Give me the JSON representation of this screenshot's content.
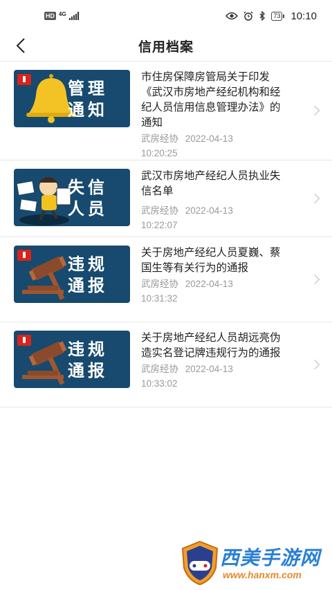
{
  "status_bar": {
    "hd": "HD",
    "network": "4G",
    "battery": "73",
    "time": "10:10"
  },
  "header": {
    "title": "信用档案",
    "back_icon": "back-chevron-icon"
  },
  "items": [
    {
      "thumb_text_line1": "管理",
      "thumb_text_line2": "通知",
      "thumb_icon": "bell-icon",
      "title": "市住房保障房管局关于印发《武汉市房地产经纪机构和经纪人员信用信息管理办法》的通知",
      "source": "武房经协",
      "date": "2022-04-13",
      "time": "10:20:25"
    },
    {
      "thumb_text_line1": "失信",
      "thumb_text_line2": "人员",
      "thumb_icon": "cartoon-person-icon",
      "title": "武汉市房地产经纪人员执业失信名单",
      "source": "武房经协",
      "date": "2022-04-13",
      "time": "10:22:07"
    },
    {
      "thumb_text_line1": "违规",
      "thumb_text_line2": "通报",
      "thumb_icon": "gavel-icon",
      "title": "关于房地产经纪人员夏巍、蔡国生等有关行为的通报",
      "source": "武房经协",
      "date": "2022-04-13",
      "time": "10:31:32"
    },
    {
      "thumb_text_line1": "违规",
      "thumb_text_line2": "通报",
      "thumb_icon": "gavel-icon",
      "title": "关于房地产经纪人员胡远亮伪造实名登记牌违规行为的通报",
      "source": "武房经协",
      "date": "2022-04-13",
      "time": "10:33:02"
    }
  ],
  "watermark": {
    "name": "西美手游网",
    "url": "www.hanxm.com"
  },
  "colors": {
    "thumb_bg": "#174a6e",
    "accent_red": "#d9231c",
    "meta_gray": "#999999",
    "watermark_blue": "#2a7fd4",
    "watermark_orange": "#e5892a"
  }
}
